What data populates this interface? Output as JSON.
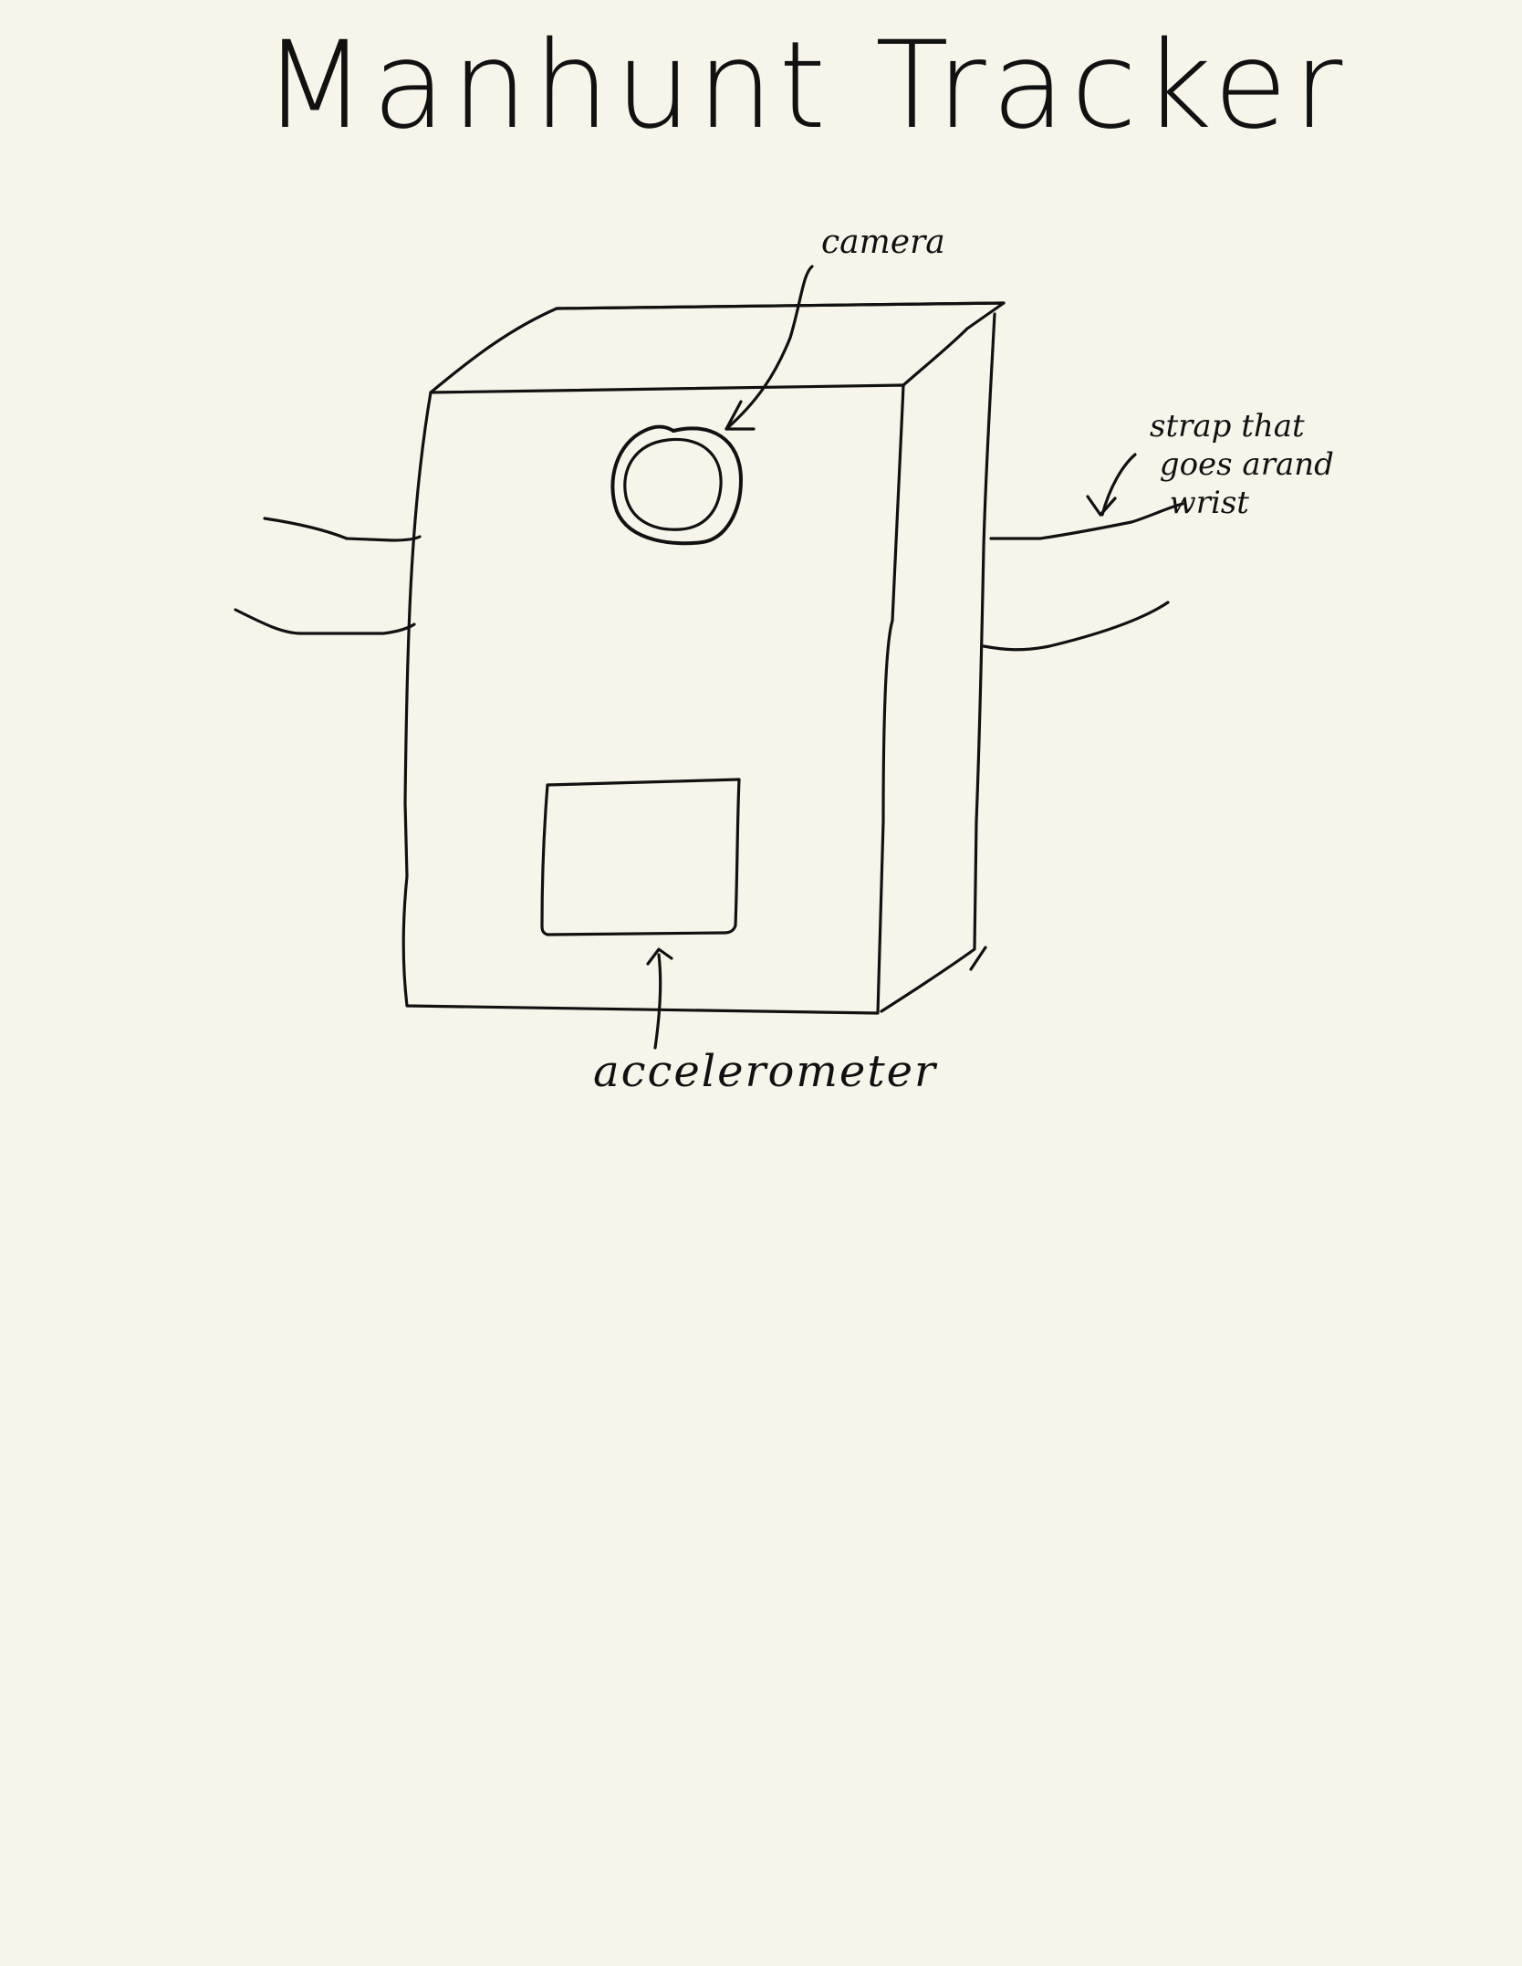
{
  "title": "Manhunt Tracker",
  "labels": {
    "camera": "camera",
    "strap": "strap that\n goes arand\n  wrist",
    "accelerometer": "accelerometer"
  },
  "colors": {
    "paper": "#f7f5ea",
    "ink": "#111111"
  }
}
